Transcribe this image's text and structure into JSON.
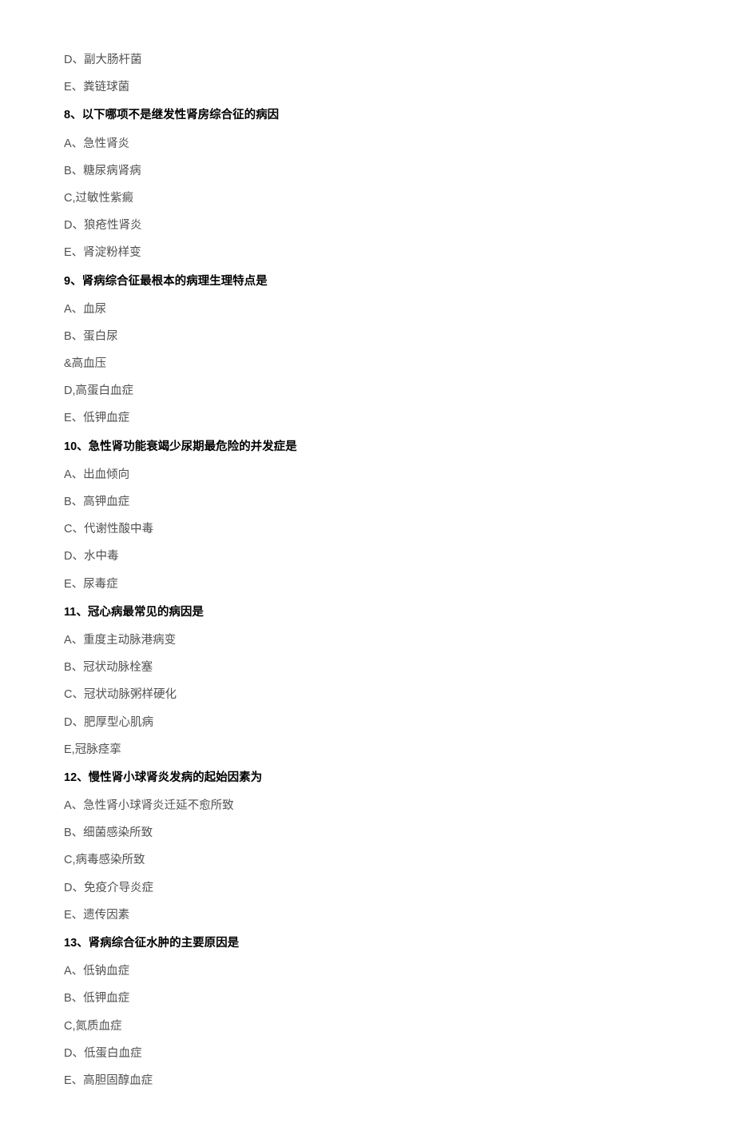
{
  "leadingOptions": [
    "D、副大肠杆菌",
    "E、粪链球菌"
  ],
  "questions": [
    {
      "q": "8、以下哪项不是继发性肾房综合征的病因",
      "options": [
        "A、急性肾炎",
        "B、糖尿病肾病",
        "C,过敏性紫癜",
        "D、狼疮性肾炎",
        "E、肾淀粉样变"
      ]
    },
    {
      "q": "9、肾病综合征最根本的病理生理特点是",
      "options": [
        "A、血尿",
        "B、蛋白尿",
        "&高血压",
        "D,高蛋白血症",
        "E、低钾血症"
      ]
    },
    {
      "q": "10、急性肾功能衰竭少尿期最危险的并发症是",
      "options": [
        "A、出血倾向",
        "B、高钾血症",
        "C、代谢性酸中毒",
        "D、水中毒",
        "E、尿毒症"
      ]
    },
    {
      "q": "11、冠心病最常见的病因是",
      "options": [
        "A、重度主动脉港病变",
        "B、冠状动脉栓塞",
        "C、冠状动脉粥样硬化",
        "D、肥厚型心肌病",
        "E,冠脉痉挛"
      ]
    },
    {
      "q": "12、慢性肾小球肾炎发病的起始因素为",
      "options": [
        "A、急性肾小球肾炎迁延不愈所致",
        "B、细菌感染所致",
        "C,病毒感染所致",
        "D、免疫介导炎症",
        "E、遗传因素"
      ]
    },
    {
      "q": "13、肾病综合征水肿的主要原因是",
      "options": [
        "A、低钠血症",
        "B、低钾血症",
        "C,氮质血症",
        "D、低蛋白血症",
        "E、高胆固醇血症"
      ]
    }
  ]
}
